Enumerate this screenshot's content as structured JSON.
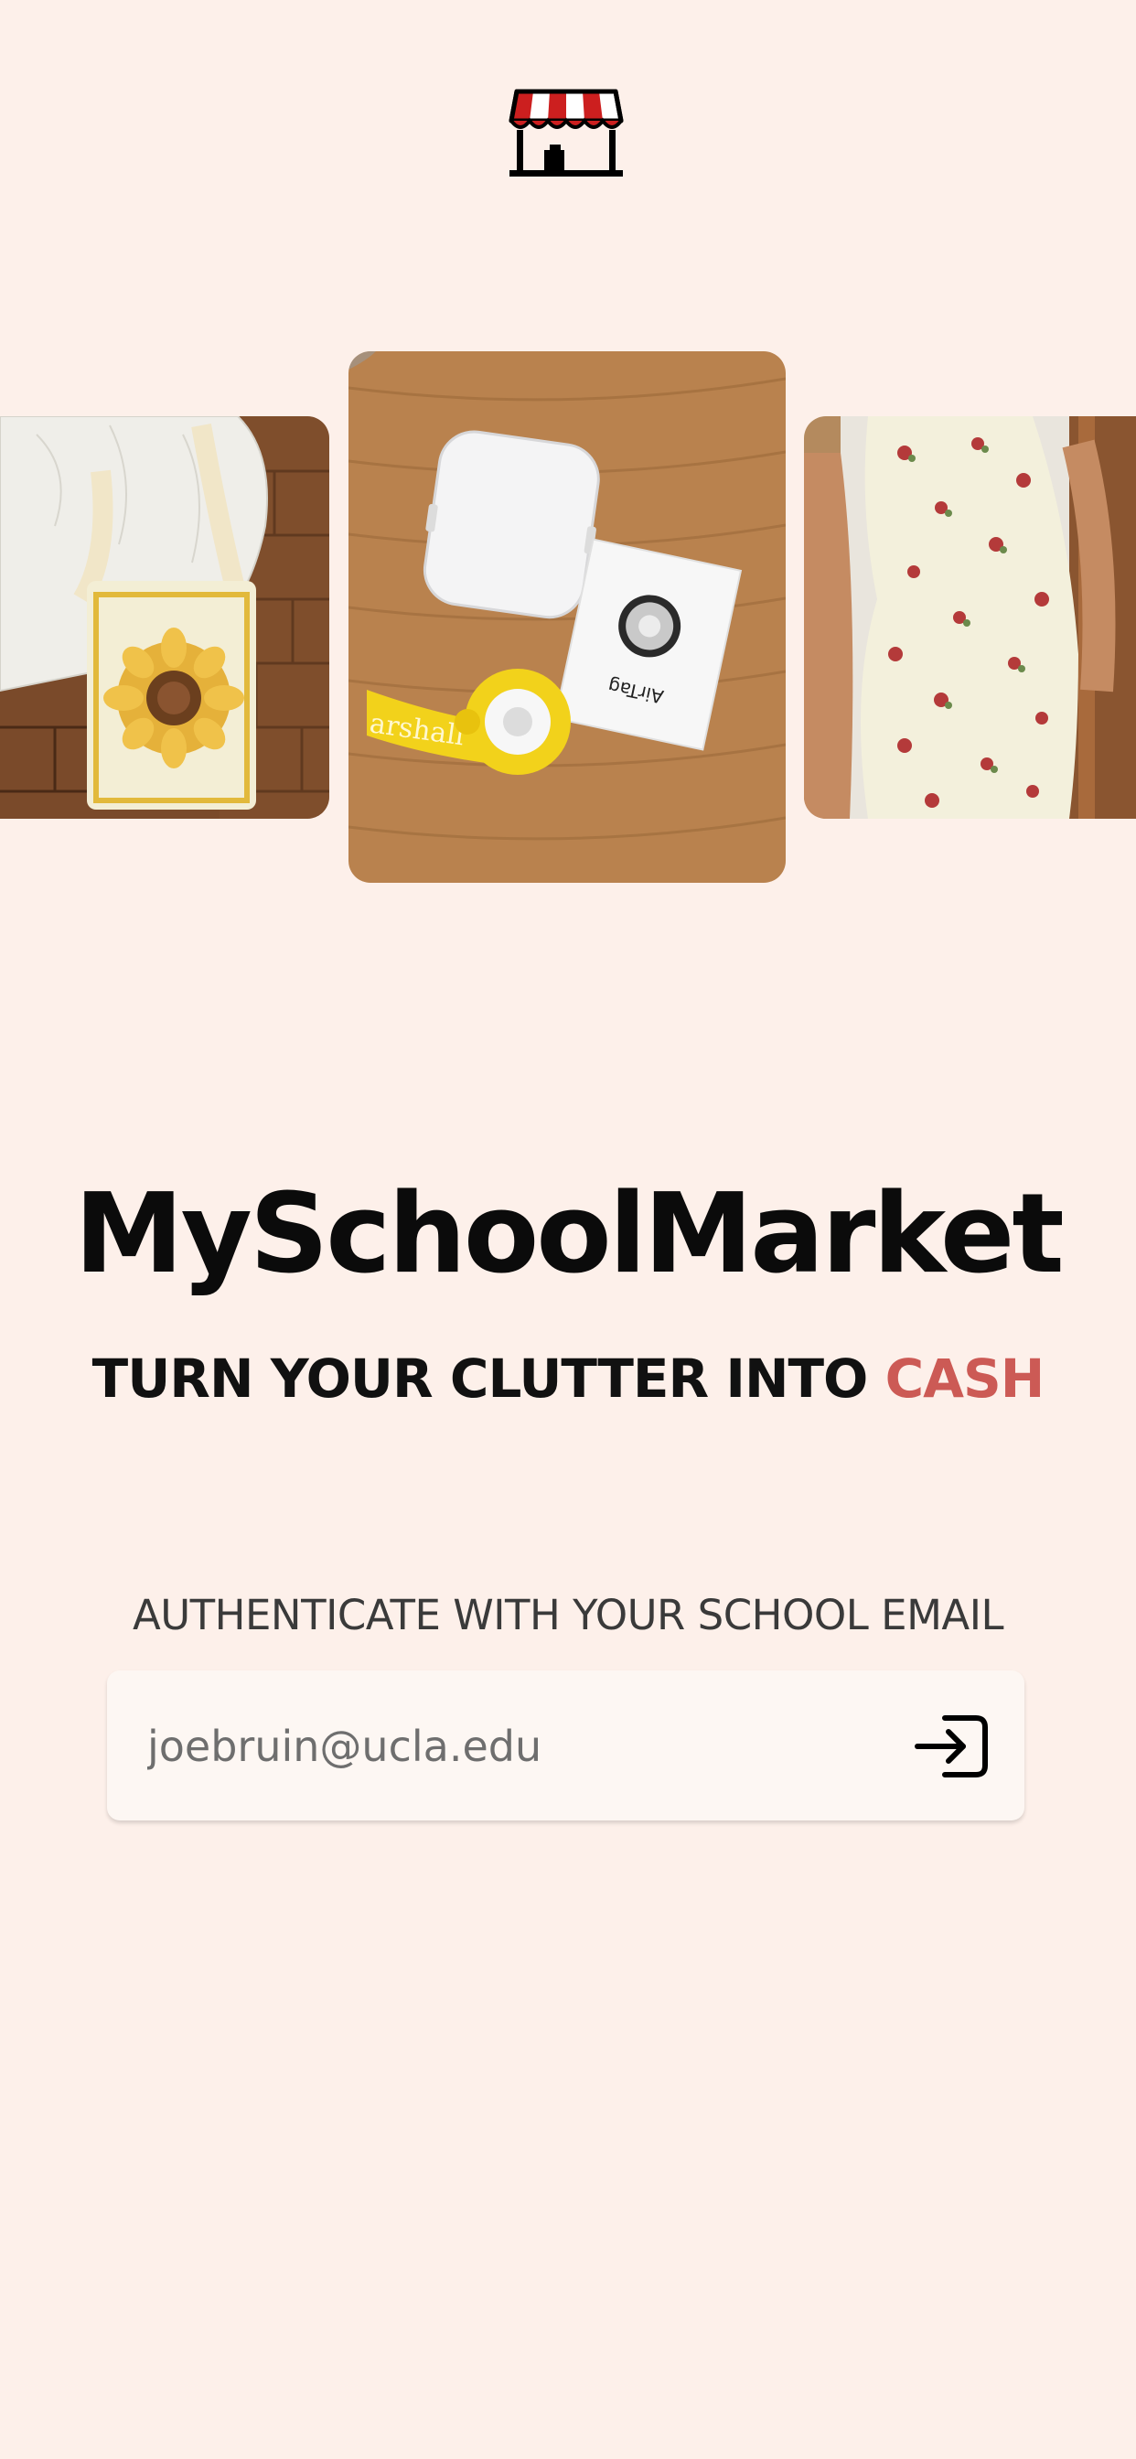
{
  "brand": {
    "title": "MySchoolMarket",
    "tagline_main": "TURN YOUR CLUTTER INTO ",
    "tagline_accent": "CASH",
    "accent_color": "#cc5a55"
  },
  "photos": {
    "center_label_1": "arshall",
    "center_label_2": "AirTag"
  },
  "auth": {
    "label": "AUTHENTICATE WITH YOUR SCHOOL EMAIL",
    "email_placeholder": "joebruin@ucla.edu",
    "submit_icon": "login-icon"
  },
  "colors": {
    "background": "#fdf0ea",
    "input_background": "#fdf7f3",
    "awning_red": "#cc1f1f"
  }
}
